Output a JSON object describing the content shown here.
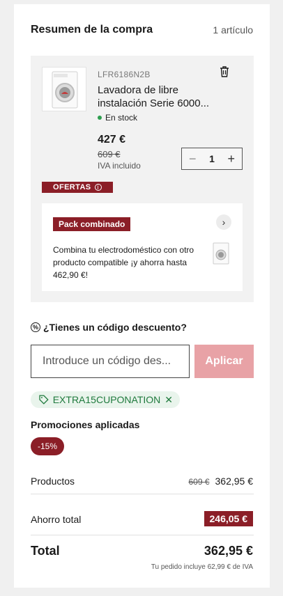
{
  "header": {
    "title": "Resumen de la compra",
    "count": "1 artículo"
  },
  "product": {
    "sku": "LFR6186N2B",
    "title": "Lavadora de libre instalación Serie 6000...",
    "stock": "En stock",
    "price": "427 €",
    "old_price": "609 €",
    "vat_note": "IVA incluido",
    "quantity": "1",
    "offers_label": "OFERTAS",
    "stock_color": "#2e9e4f"
  },
  "pack": {
    "badge": "Pack combinado",
    "text": "Combina tu electrodoméstico con otro producto compatible ¡y ahorra hasta 462,90 €!"
  },
  "discount": {
    "question": "¿Tienes un código descuento?",
    "placeholder": "Introduce un código des...",
    "apply_label": "Aplicar",
    "coupon_code": "EXTRA15CUPONATION"
  },
  "promotions": {
    "title": "Promociones aplicadas",
    "badge": "-15%"
  },
  "summary": {
    "products_label": "Productos",
    "products_old": "609 €",
    "products_value": "362,95 €",
    "savings_label": "Ahorro total",
    "savings_value": "246,05 €",
    "total_label": "Total",
    "total_value": "362,95 €",
    "tax_note": "Tu pedido incluye 62,99 € de IVA"
  },
  "colors": {
    "accent": "#8b1e27",
    "apply_button": "#e8a2a6",
    "coupon_text": "#1f7a3d"
  }
}
